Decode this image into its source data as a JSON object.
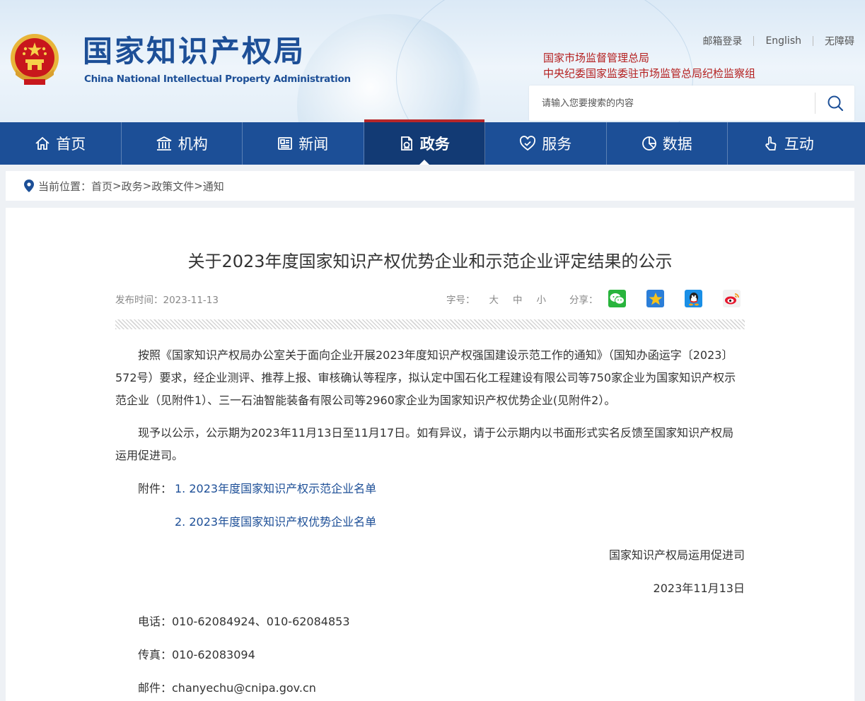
{
  "header": {
    "title": "国家知识产权局",
    "subtitle": "China National Intellectual Property Administration",
    "top_links": [
      "邮箱登录",
      "English",
      "无障碍"
    ],
    "org_links": [
      "国家市场监督管理总局",
      "中央纪委国家监委驻市场监管总局纪检监察组"
    ],
    "search": {
      "placeholder": "请输入您要搜索的内容",
      "icon": "search-icon"
    }
  },
  "nav": {
    "items": [
      {
        "label": "首页",
        "icon": "home-icon"
      },
      {
        "label": "机构",
        "icon": "institution-icon"
      },
      {
        "label": "新闻",
        "icon": "news-icon"
      },
      {
        "label": "政务",
        "icon": "government-icon",
        "active": true
      },
      {
        "label": "服务",
        "icon": "service-icon"
      },
      {
        "label": "数据",
        "icon": "data-icon"
      },
      {
        "label": "互动",
        "icon": "interact-icon"
      }
    ],
    "colors": {
      "bar": "#1c4f97",
      "active": "#123a74",
      "accent": "#b6272a"
    }
  },
  "breadcrumb": {
    "prefix": "当前位置：",
    "items": [
      "首页",
      "政务",
      "政策文件",
      "通知"
    ],
    "sep": ">"
  },
  "article": {
    "title": "关于2023年度国家知识产权优势企业和示范企业评定结果的公示",
    "publish_label": "发布时间：",
    "publish_date": "2023-11-13",
    "font_size_label": "字号：",
    "font_sizes": [
      "大",
      "中",
      "小"
    ],
    "share_label": "分享：",
    "share_icons": [
      "wechat-icon",
      "qzone-icon",
      "qq-icon",
      "weibo-icon"
    ],
    "paragraph1": "按照《国家知识产权局办公室关于面向企业开展2023年度知识产权强国建设示范工作的通知》（国知办函运字〔2023〕572号）要求，经企业测评、推荐上报、审核确认等程序，拟认定中国石化工程建设有限公司等750家企业为国家知识产权示范企业（见附件1）、三一石油智能装备有限公司等2960家企业为国家知识产权优势企业(见附件2）。",
    "paragraph2": "现予以公示，公示期为2023年11月13日至11月17日。如有异议，请于公示期内以书面形式实名反馈至国家知识产权局运用促进司。",
    "attachment_label": "附件：",
    "attachments": [
      "1. 2023年度国家知识产权示范企业名单",
      "2. 2023年度国家知识产权优势企业名单"
    ],
    "signature": "国家知识产权局运用促进司",
    "date": "2023年11月13日",
    "tel": "电话：010-62084924、010-62084853",
    "fax": "传真：010-62083094",
    "email": "邮件：chanyechu@cnipa.gov.cn"
  }
}
